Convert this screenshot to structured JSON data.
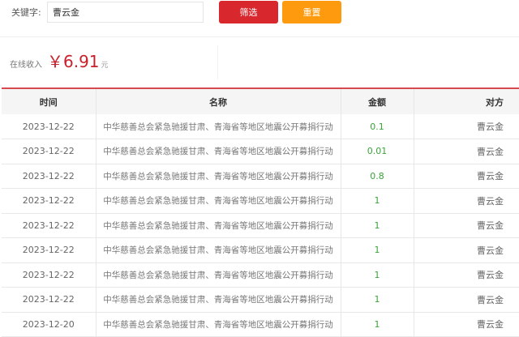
{
  "filter": {
    "keyword_label": "关键字:",
    "keyword_value": "曹云金",
    "filter_button": "筛选",
    "reset_button": "重置"
  },
  "income": {
    "label": "在线收入",
    "amount": "￥6.91",
    "unit": "元"
  },
  "table": {
    "headers": [
      "时间",
      "名称",
      "金额",
      "对方"
    ],
    "rows": [
      [
        "2023-12-22",
        "中华慈善总会紧急驰援甘肃、青海省等地区地震公开募捐行动",
        "0.1",
        "曹云金"
      ],
      [
        "2023-12-22",
        "中华慈善总会紧急驰援甘肃、青海省等地区地震公开募捐行动",
        "0.01",
        "曹云金"
      ],
      [
        "2023-12-22",
        "中华慈善总会紧急驰援甘肃、青海省等地区地震公开募捐行动",
        "0.8",
        "曹云金"
      ],
      [
        "2023-12-22",
        "中华慈善总会紧急驰援甘肃、青海省等地区地震公开募捐行动",
        "1",
        "曹云金"
      ],
      [
        "2023-12-22",
        "中华慈善总会紧急驰援甘肃、青海省等地区地震公开募捐行动",
        "1",
        "曹云金"
      ],
      [
        "2023-12-22",
        "中华慈善总会紧急驰援甘肃、青海省等地区地震公开募捐行动",
        "1",
        "曹云金"
      ],
      [
        "2023-12-22",
        "中华慈善总会紧急驰援甘肃、青海省等地区地震公开募捐行动",
        "1",
        "曹云金"
      ],
      [
        "2023-12-22",
        "中华慈善总会紧急驰援甘肃、青海省等地区地震公开募捐行动",
        "1",
        "曹云金"
      ],
      [
        "2023-12-20",
        "中华慈善总会紧急驰援甘肃、青海省等地区地震公开募捐行动",
        "1",
        "曹云金"
      ]
    ]
  }
}
